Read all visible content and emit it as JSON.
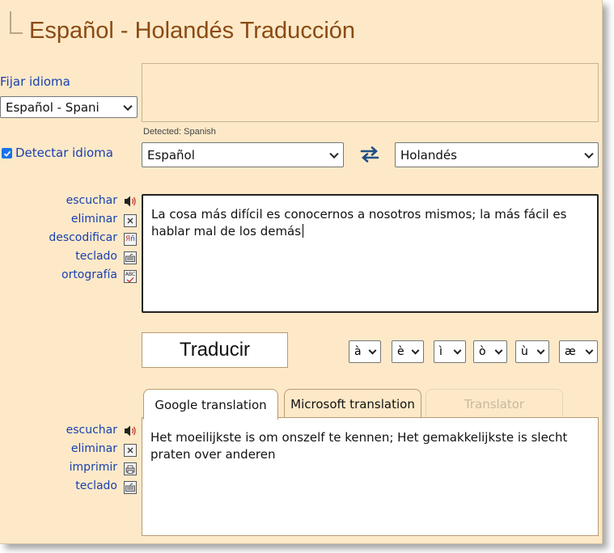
{
  "title": "Español - Holandés Traducción",
  "fix_language": {
    "label": "Fijar idioma",
    "selected": "Español - Spani"
  },
  "detect": {
    "label": "Detectar idioma",
    "checked": true,
    "detected_text": "Detected: Spanish"
  },
  "source_language": "Español",
  "target_language": "Holandés",
  "swap_icon": "swap-arrows-icon",
  "source_tools": [
    {
      "label": "escuchar",
      "icon": "speaker-icon"
    },
    {
      "label": "eliminar",
      "icon": "delete-icon"
    },
    {
      "label": "descodificar",
      "icon": "decode-icon"
    },
    {
      "label": "teclado",
      "icon": "keyboard-icon"
    },
    {
      "label": "ortografía",
      "icon": "spellcheck-icon"
    }
  ],
  "source_text": "La cosa más difícil es conocernos a nosotros mismos; la más fácil es hablar mal de los demás",
  "translate_button": "Traducir",
  "accents": [
    "à",
    "è",
    "ì",
    "ò",
    "ù",
    "æ"
  ],
  "tabs": [
    {
      "label": "Google translation",
      "active": true
    },
    {
      "label": "Microsoft translation",
      "active": false
    },
    {
      "label": "Translator",
      "active": false,
      "disabled": true
    }
  ],
  "result_tools": [
    {
      "label": "escuchar",
      "icon": "speaker-icon"
    },
    {
      "label": "eliminar",
      "icon": "delete-icon"
    },
    {
      "label": "imprimir",
      "icon": "print-icon"
    },
    {
      "label": "teclado",
      "icon": "keyboard-icon"
    }
  ],
  "result_text": "Het moeilijkste is om onszelf te kennen; Het gemakkelijkste is slecht praten over anderen",
  "colors": {
    "panel_bg": "#fde9c8",
    "title": "#8a4a14",
    "link": "#1a3fb0",
    "swap_icon": "#1f4f86"
  }
}
